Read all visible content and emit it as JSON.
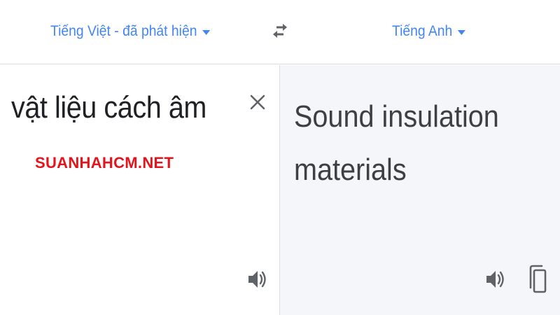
{
  "source_language": {
    "label": "Tiếng Việt - đã phát hiện"
  },
  "target_language": {
    "label": "Tiếng Anh"
  },
  "source": {
    "text": "vật liệu cách âm"
  },
  "target": {
    "text": "Sound insulation materials"
  },
  "watermark": {
    "text": "SUANHAHCM.NET"
  },
  "icons": {
    "swap": "swap-arrows-icon",
    "clear": "close-icon",
    "listen": "speaker-icon",
    "copy": "copy-icon",
    "dropdown": "caret-down-icon"
  },
  "colors": {
    "accent": "#4285f4",
    "watermark": "#e3141b",
    "target_panel_bg": "#f5f6f9",
    "icon": "#5f6368"
  }
}
